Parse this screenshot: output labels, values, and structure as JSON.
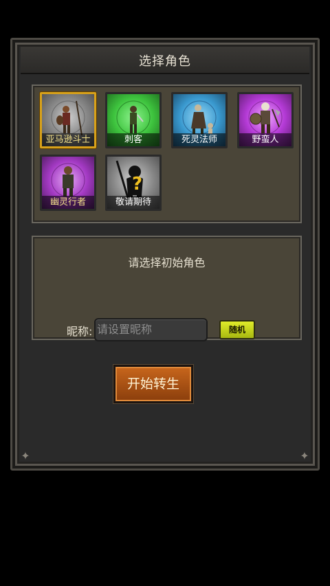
{
  "dialog": {
    "title": "选择角色"
  },
  "roles": [
    {
      "label": "亚马逊斗士",
      "selected": true,
      "color": "#8a8a8a",
      "icon": "amazon-warrior-portrait"
    },
    {
      "label": "刺客",
      "selected": false,
      "color": "#3ec43e",
      "icon": "assassin-portrait"
    },
    {
      "label": "死灵法师",
      "selected": false,
      "color": "#3a9ad0",
      "icon": "necromancer-portrait"
    },
    {
      "label": "野蛮人",
      "selected": false,
      "color": "#b43ad6",
      "icon": "barbarian-portrait"
    },
    {
      "label": "幽灵行者",
      "selected": false,
      "color": "#a43ac4",
      "icon": "ghost-walker-portrait"
    },
    {
      "label": "敬请期待",
      "selected": false,
      "color": "#8a8a8a",
      "icon": "locked-question-portrait"
    }
  ],
  "description": {
    "text": "请选择初始角色"
  },
  "nickname": {
    "label": "昵称:",
    "placeholder": "请设置昵称",
    "random_label": "随机"
  },
  "start_button": {
    "label": "开始转生"
  }
}
